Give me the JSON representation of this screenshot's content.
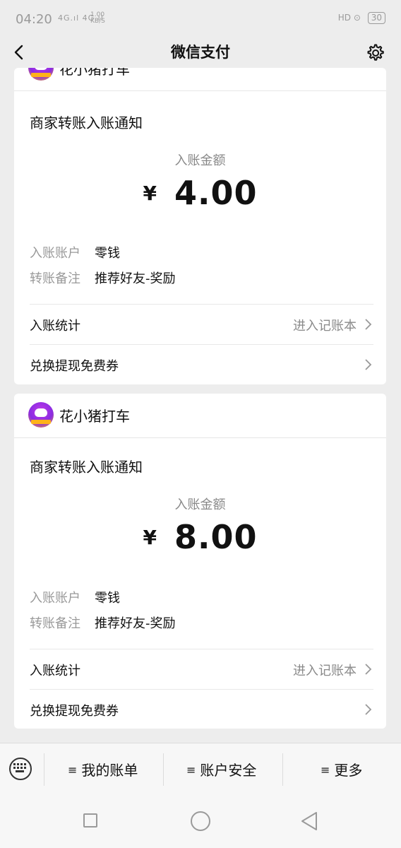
{
  "status_bar": {
    "time": "04:20",
    "signal": "4G.ıl 4G.ıl",
    "speed": "1.00",
    "speed_unit": "KB/S",
    "right_icons": "HD ⊙",
    "battery": "30"
  },
  "nav": {
    "title": "微信支付",
    "back_icon": "chevron-left-icon",
    "settings_icon": "gear-icon"
  },
  "cards": [
    {
      "merchant": "花小猪打车",
      "notice_title": "商家转账入账通知",
      "amount_label": "入账金额",
      "currency": "¥",
      "amount": "4.00",
      "account_label": "入账账户",
      "account_value": "零钱",
      "remark_label": "转账备注",
      "remark_value": "推荐好友-奖励",
      "stats_label": "入账统计",
      "stats_link": "进入记账本",
      "exchange_label": "兑换提现免费券"
    },
    {
      "merchant": "花小猪打车",
      "notice_title": "商家转账入账通知",
      "amount_label": "入账金额",
      "currency": "¥",
      "amount": "8.00",
      "account_label": "入账账户",
      "account_value": "零钱",
      "remark_label": "转账备注",
      "remark_value": "推荐好友-奖励",
      "stats_label": "入账统计",
      "stats_link": "进入记账本",
      "exchange_label": "兑换提现免费券"
    }
  ],
  "menu": {
    "items": [
      {
        "label": "我的账单"
      },
      {
        "label": "账户安全"
      },
      {
        "label": "更多"
      }
    ],
    "menu_glyph": "≡"
  }
}
